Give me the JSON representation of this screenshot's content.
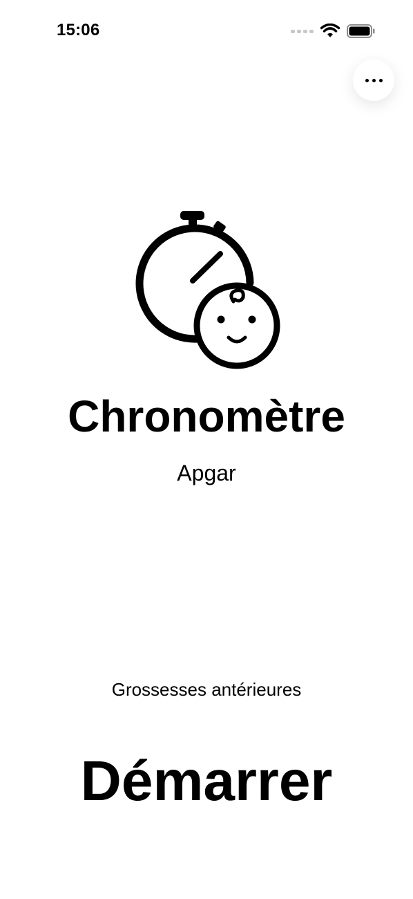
{
  "status_bar": {
    "time": "15:06",
    "icons": [
      "signal-icon",
      "wifi-icon",
      "battery-icon"
    ]
  },
  "header": {
    "more_icon": "more-horizontal-icon"
  },
  "hero": {
    "icon": "stopwatch-baby-icon",
    "title": "Chronomètre",
    "subtitle": "Apgar"
  },
  "options": {
    "previous_pregnancies_label": "Grossesses antérieures"
  },
  "actions": {
    "start_label": "Démarrer"
  },
  "colors": {
    "background": "#ffffff",
    "foreground": "#000000",
    "inactive_signal": "#c8c8c8"
  }
}
